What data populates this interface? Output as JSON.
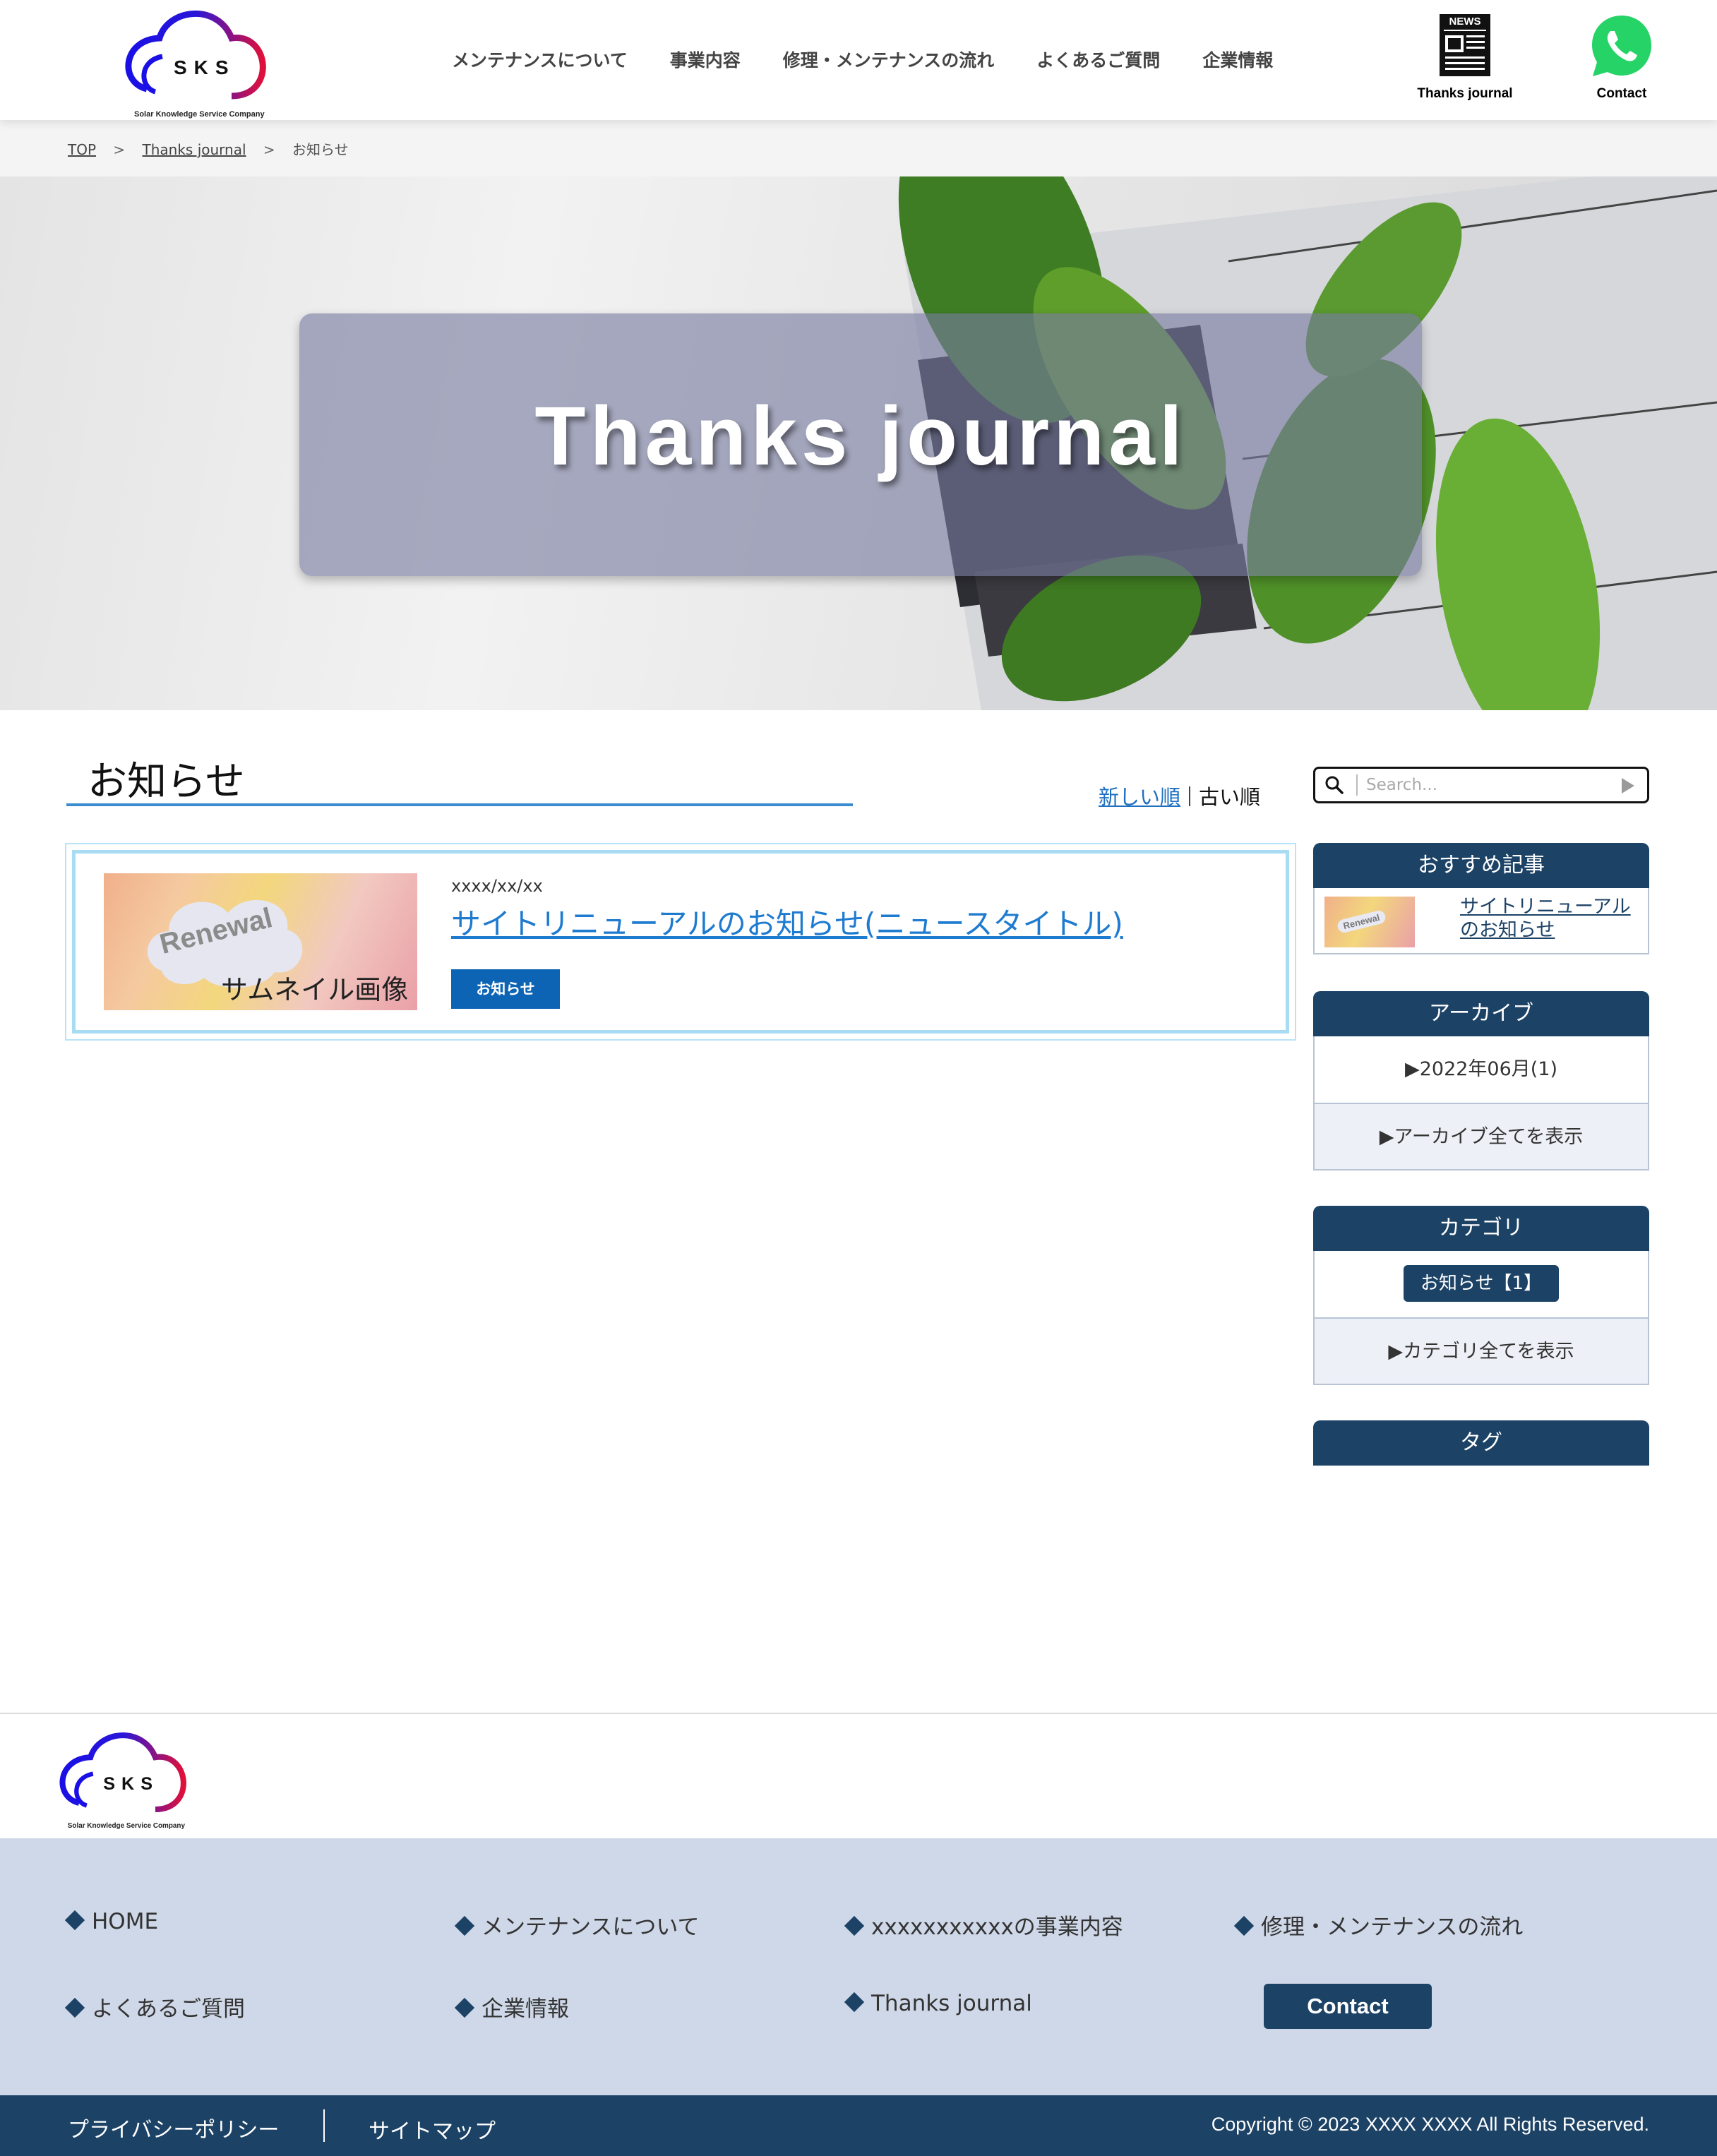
{
  "header": {
    "logo_text": "SKS",
    "logo_sub": "Solar Knowledge Service Company",
    "nav": [
      "メンテナンスについて",
      "事業内容",
      "修理・メンテナンスの流れ",
      "よくあるご質問",
      "企業情報"
    ],
    "news_icon_label": "NEWS",
    "news_caption": "Thanks journal",
    "contact_caption": "Contact"
  },
  "breadcrumb": {
    "items": [
      "TOP",
      "Thanks journal",
      "お知らせ"
    ],
    "separator": ">"
  },
  "hero": {
    "title": "Thanks journal"
  },
  "main": {
    "heading": "お知らせ",
    "sort_new": "新しい順",
    "sort_old": "古い順",
    "post": {
      "thumb_word": "Renewal",
      "thumb_label": "サムネイル画像",
      "date": "xxxx/xx/xx",
      "title": "サイトリニューアルのお知らせ(ニュースタイトル)",
      "tag": "お知らせ"
    }
  },
  "sidebar": {
    "search_placeholder": "Search...",
    "recommended": {
      "heading": "おすすめ記事",
      "thumb_word": "Renewal",
      "link": "サイトリニューアルのお知らせ"
    },
    "archive": {
      "heading": "アーカイブ",
      "item": "▶2022年06月(1)",
      "show_all": "▶アーカイブ全てを表示"
    },
    "category": {
      "heading": "カテゴリ",
      "item": "お知らせ【1】",
      "show_all": "▶カテゴリ全てを表示"
    },
    "tag": {
      "heading": "タグ"
    }
  },
  "footer": {
    "links": [
      "HOME",
      "メンテナンスについて",
      "xxxxxxxxxxxの事業内容",
      "修理・メンテナンスの流れ",
      "よくあるご質問",
      "企業情報",
      "Thanks journal"
    ],
    "contact": "Contact",
    "privacy": "プライバシーポリシー",
    "sitemap": "サイトマップ",
    "copyright": "Copyright © 2023 XXXX XXXX All Rights Reserved."
  },
  "colors": {
    "navy": "#1c4266",
    "link_blue": "#1f7bd0",
    "footer_bg": "#cfd8e8",
    "whatsapp_green": "#25d366"
  }
}
